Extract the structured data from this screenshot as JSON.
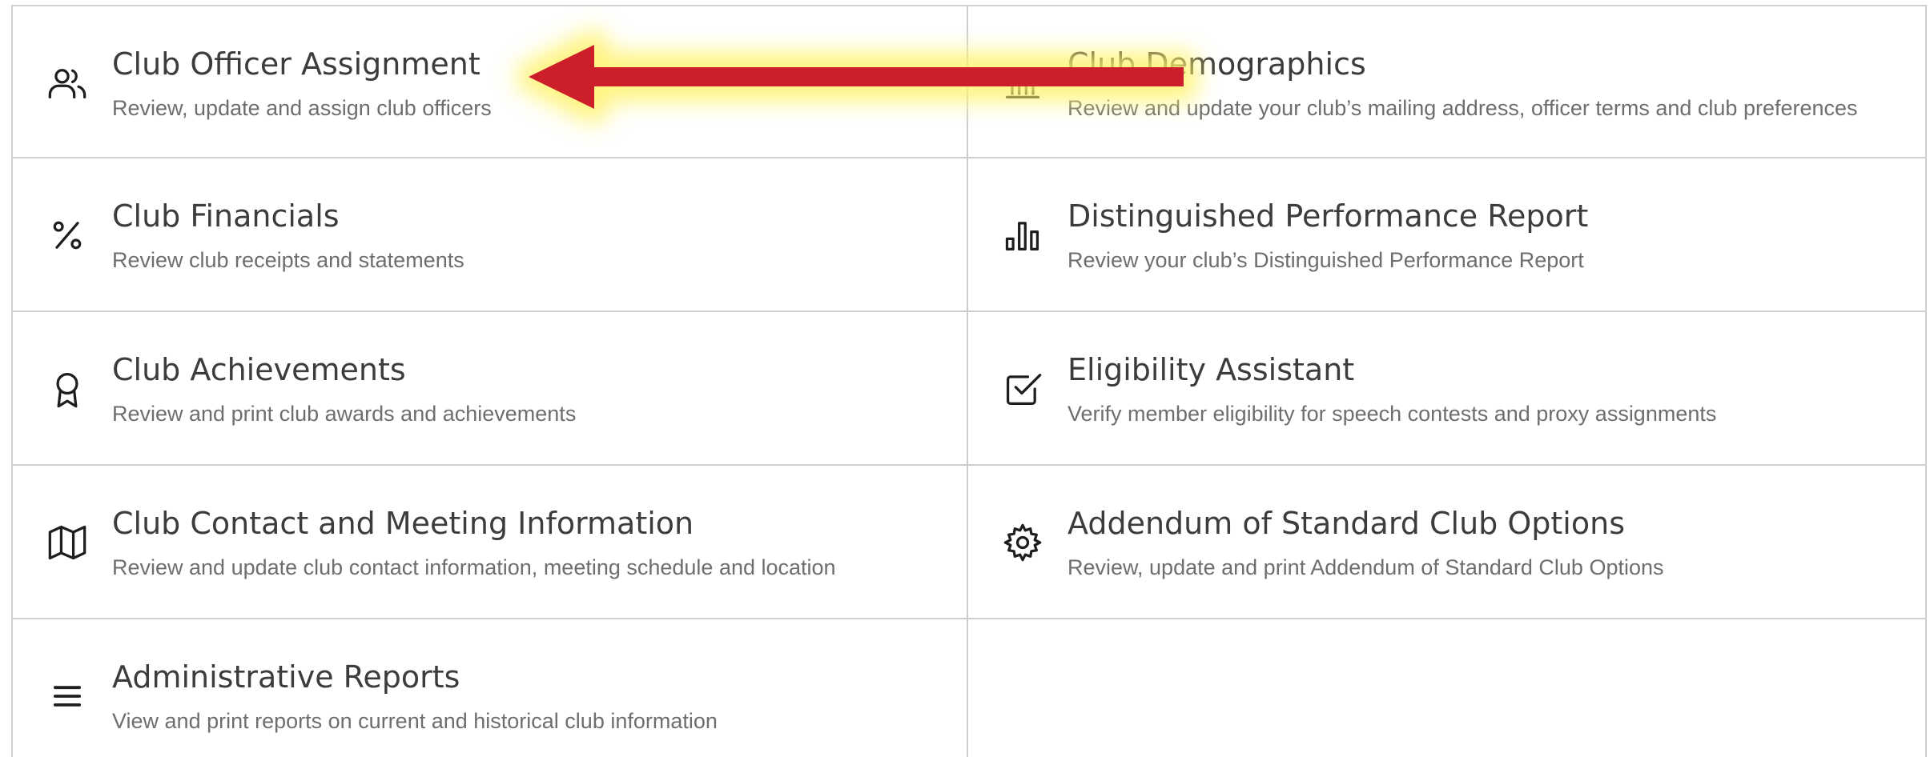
{
  "tiles": [
    {
      "id": "club-officer-assignment",
      "icon": "users-icon",
      "title": "Club Officer Assignment",
      "description": "Review, update and assign club officers"
    },
    {
      "id": "club-demographics",
      "icon": "bank-icon",
      "title": "Club Demographics",
      "description": "Review and update your club’s mailing address, officer terms and club preferences"
    },
    {
      "id": "club-financials",
      "icon": "percent-icon",
      "title": "Club Financials",
      "description": "Review club receipts and statements"
    },
    {
      "id": "distinguished-performance-report",
      "icon": "bar-chart-icon",
      "title": "Distinguished Performance Report",
      "description": "Review your club’s Distinguished Performance Report"
    },
    {
      "id": "club-achievements",
      "icon": "award-icon",
      "title": "Club Achievements",
      "description": "Review and print club awards and achievements"
    },
    {
      "id": "eligibility-assistant",
      "icon": "checkbox-icon",
      "title": "Eligibility Assistant",
      "description": "Verify member eligibility for speech contests and proxy assignments"
    },
    {
      "id": "club-contact-meeting-information",
      "icon": "map-icon",
      "title": "Club Contact and Meeting Information",
      "description": "Review and update club contact information, meeting schedule and location"
    },
    {
      "id": "addendum-standard-club-options",
      "icon": "gear-icon",
      "title": "Addendum of Standard Club Options",
      "description": "Review, update and print Addendum of Standard Club Options"
    },
    {
      "id": "administrative-reports",
      "icon": "list-icon",
      "title": "Administrative Reports",
      "description": "View and print reports on current and historical club information"
    }
  ],
  "annotation": {
    "arrow_color": "#cc1f2a",
    "glow_color": "#fff36a"
  }
}
